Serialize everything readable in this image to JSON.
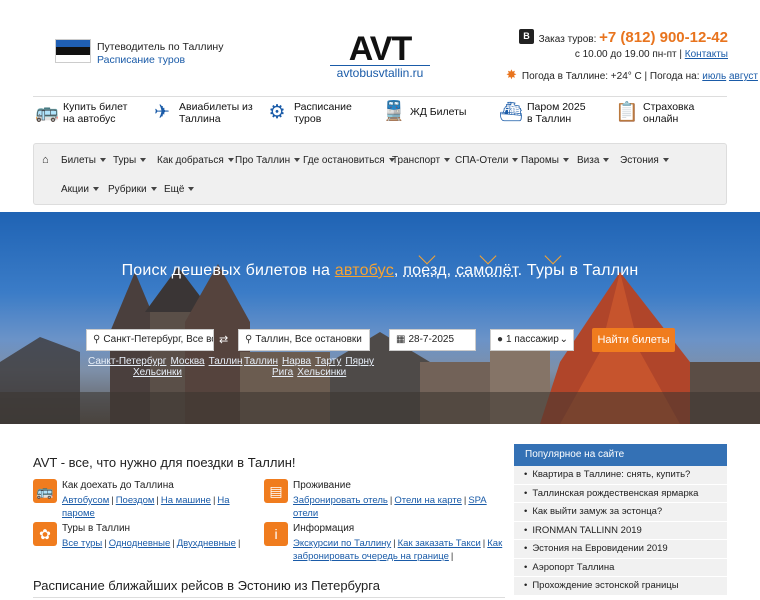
{
  "header": {
    "guide_link": "Путеводитель по Таллину",
    "tours_link": "Расписание туров",
    "logo_main": "AVT",
    "logo_sub": "avtobusvtallin.ru",
    "vk_label": "В",
    "order_label": "Заказ туров:",
    "phone": "+7 (812) 900-12-42",
    "hours": "с 10.00 до 19.00 пн-пт",
    "contacts_link": "Контакты",
    "weather_text": "Погода в Таллине: +24° C | Погода на:",
    "weather_july": "июль",
    "weather_august": "август"
  },
  "services": [
    {
      "icon": "bus-icon",
      "label1": "Купить билет",
      "label2": "на автобус"
    },
    {
      "icon": "plane-icon",
      "label1": "Авиабилеты из",
      "label2": "Таллина"
    },
    {
      "icon": "compass-icon",
      "label1": "Расписание",
      "label2": "туров"
    },
    {
      "icon": "train-icon",
      "label1": "ЖД Билеты",
      "label2": ""
    },
    {
      "icon": "ship-icon",
      "label1": "Паром 2025",
      "label2": "в Таллин"
    },
    {
      "icon": "insurance-icon",
      "label1": "Страховка",
      "label2": "онлайн"
    }
  ],
  "nav": {
    "home_icon": "home-icon",
    "items": [
      "Билеты",
      "Туры",
      "Как добраться",
      "Про Таллин",
      "Где остановиться",
      "Транспорт",
      "СПА-Отели",
      "Паромы",
      "Виза",
      "Эстония",
      "Акции",
      "Рубрики",
      "Ещё"
    ]
  },
  "hero": {
    "title_prefix": "Поиск дешевых билетов на",
    "opt_bus": "автобус",
    "comma1": ",",
    "opt_train": "поезд",
    "comma2": ",",
    "opt_plane": "самолёт",
    "title_suffix": ". Туры в Таллин",
    "from_value": "Санкт-Петербург, Все вокз",
    "to_value": "Таллин, Все остановки",
    "date_value": "28-7-2025",
    "passengers_value": "1 пассажир",
    "search_button": "Найти билеты",
    "from_quick": [
      "Санкт-Петербург",
      "Москва",
      "Таллин"
    ],
    "from_quick2": [
      "Хельсинки"
    ],
    "to_quick": [
      "Таллин",
      "Нарва",
      "Тарту",
      "Пярну"
    ],
    "to_quick2": [
      "Рига",
      "Хельсинки"
    ]
  },
  "main": {
    "title": "AVT - все, что нужно для поездки в Таллин!",
    "blocks": [
      {
        "title": "Как доехать до Таллина",
        "links": [
          "Автобусом",
          "Поездом",
          "На машине",
          "На пароме"
        ]
      },
      {
        "title": "Проживание",
        "links": [
          "Забронировать отель",
          "Отели на карте",
          "SPA отели"
        ]
      },
      {
        "title": "Туры в Таллин",
        "links": [
          "Все туры",
          "Однодневные",
          "Двухдневные"
        ]
      },
      {
        "title": "Информация",
        "links": [
          "Экскурсии по Таллину",
          "Как заказать Такси",
          "Как"
        ],
        "links2": [
          "забронировать очередь на границе"
        ]
      }
    ],
    "schedule_title": "Расписание ближайших рейсов в Эстонию из Петербурга"
  },
  "popular": {
    "title": "Популярное на сайте",
    "items": [
      "Квартира в Таллине: снять, купить?",
      "Таллинская рождественская ярмарка",
      "Как выйти замуж за эстонца?",
      "IRONMAN TALLINN 2019",
      "Эстония на Евровидении 2019",
      "Аэропорт Таллина",
      "Прохождение эстонской границы"
    ]
  },
  "colors": {
    "accent_orange": "#f07c1e",
    "link_blue": "#1a5ba8",
    "header_blue": "#3471b5"
  }
}
